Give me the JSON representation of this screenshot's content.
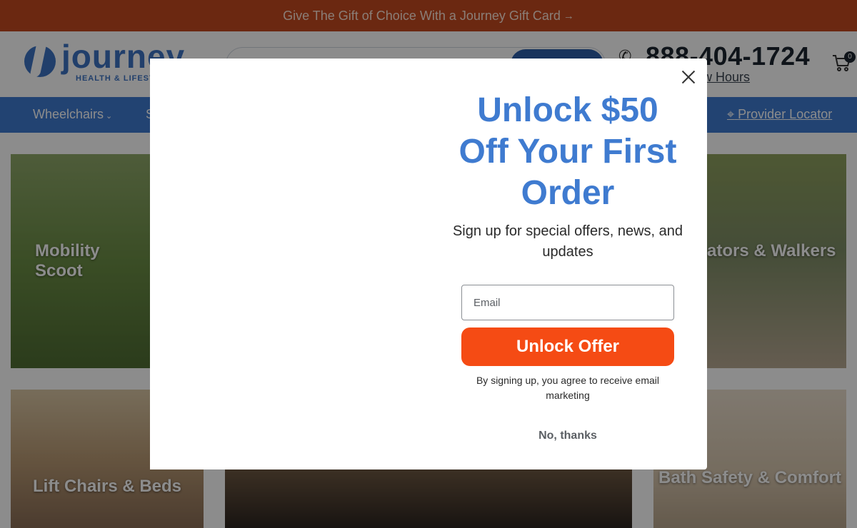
{
  "promo_bar": {
    "text": "Give The Gift of Choice With a Journey Gift Card",
    "arrow": "→"
  },
  "header": {
    "logo_word": "journey",
    "logo_sub": "HEALTH & LIFEST",
    "phone": "888-404-1724",
    "hours_link": "w Hours",
    "cart_count": "0"
  },
  "nav": {
    "items": [
      "Wheelchairs",
      "S"
    ],
    "provider_locator": "Provider Locator"
  },
  "tiles": {
    "scooters": "Mobility Scoot",
    "rollators": "ators & Walkers",
    "lift_chairs": "Lift Chairs & Beds",
    "bath": "Bath Safety & Comfort"
  },
  "modal": {
    "headline": "Unlock $50 Off Your First Order",
    "subhead": "Sign up for special offers, news, and updates",
    "email_placeholder": "Email",
    "email_value": "",
    "cta_label": "Unlock Offer",
    "disclaimer": "By signing up, you agree to receive email marketing",
    "decline_label": "No, thanks"
  },
  "colors": {
    "promo_bg": "#c34a1f",
    "brand_blue": "#3f7bd0",
    "cta_orange": "#f54b14"
  },
  "icons": {
    "close": "close-icon",
    "phone": "phone-icon",
    "cart": "cart-icon",
    "location": "map-pin-icon",
    "chevron": "chevron-down-icon"
  }
}
